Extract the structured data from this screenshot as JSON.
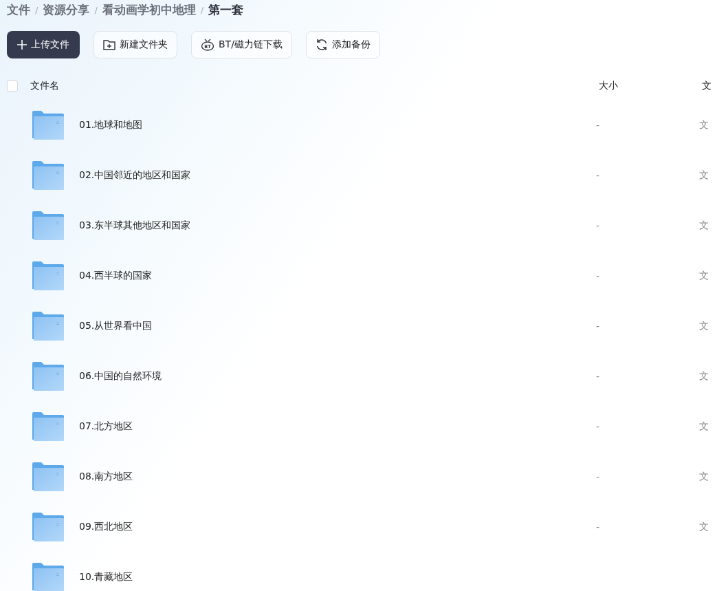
{
  "breadcrumb": [
    {
      "label": "文件",
      "current": false
    },
    {
      "label": "资源分享",
      "current": false
    },
    {
      "label": "看动画学初中地理",
      "current": false
    },
    {
      "label": "第一套",
      "current": true
    }
  ],
  "breadcrumb_separator": "/",
  "toolbar": [
    {
      "kind": "upload",
      "label": "上传文件"
    },
    {
      "kind": "new-folder",
      "label": "新建文件夹"
    },
    {
      "kind": "bt-download",
      "icon_text": "BT",
      "label": "BT/磁力链下载"
    },
    {
      "kind": "backup",
      "label": "添加备份"
    }
  ],
  "table": {
    "select_all_checked": false,
    "columns": [
      "文件名",
      "大小",
      "文"
    ],
    "rows": [
      {
        "name": "01.地球和地图",
        "size": "-",
        "column_3": "文"
      },
      {
        "name": "02.中国邻近的地区和国家",
        "size": "-",
        "column_3": "文"
      },
      {
        "name": "03.东半球其他地区和国家",
        "size": "-",
        "column_3": "文"
      },
      {
        "name": "04.西半球的国家",
        "size": "-",
        "column_3": "文"
      },
      {
        "name": "05.从世界看中国",
        "size": "-",
        "column_3": "文"
      },
      {
        "name": "06.中国的自然环境",
        "size": "-",
        "column_3": "文"
      },
      {
        "name": "07.北方地区",
        "size": "-",
        "column_3": "文"
      },
      {
        "name": "08.南方地区",
        "size": "-",
        "column_3": "文"
      },
      {
        "name": "09.西北地区",
        "size": "-",
        "column_3": "文"
      },
      {
        "name": "10.青藏地区"
      }
    ]
  }
}
